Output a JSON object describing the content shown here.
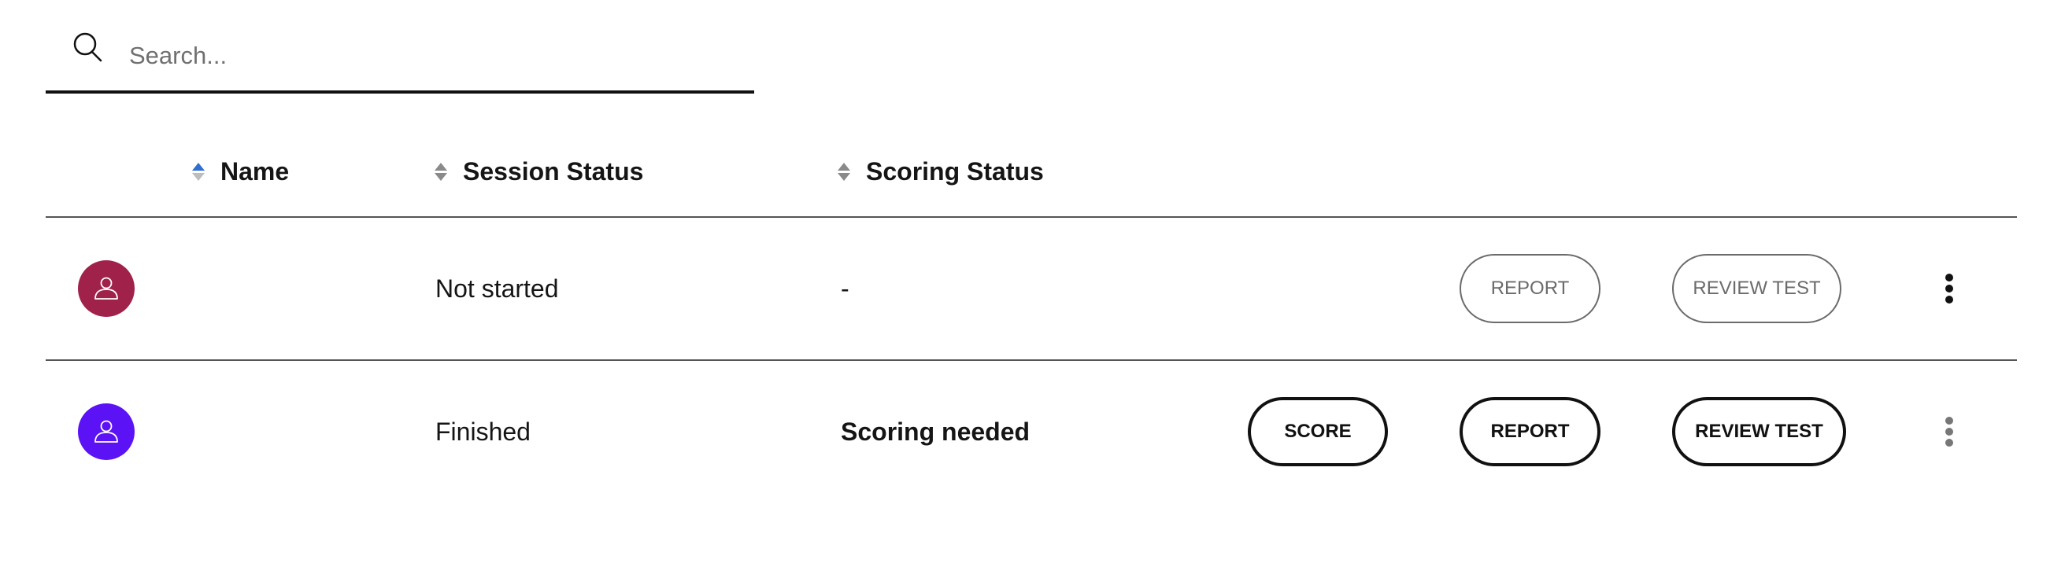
{
  "search": {
    "placeholder": "Search...",
    "value": "",
    "icon": "search-icon"
  },
  "table": {
    "columns": [
      {
        "label": "Name",
        "sort": "ascending"
      },
      {
        "label": "Session Status",
        "sort": "none"
      },
      {
        "label": "Scoring Status",
        "sort": "none"
      }
    ],
    "rows": [
      {
        "avatar_icon": "user-icon",
        "avatar_color": "#a0214a",
        "name": "",
        "session_status": "Not started",
        "scoring_status": "-",
        "actions": {
          "report": "REPORT",
          "review_test": "REVIEW TEST"
        },
        "enabled": false
      },
      {
        "avatar_icon": "user-icon",
        "avatar_color": "#5b12f5",
        "name": "",
        "session_status": "Finished",
        "scoring_status": "Scoring needed",
        "actions": {
          "score": "SCORE",
          "report": "REPORT",
          "review_test": "REVIEW TEST"
        },
        "enabled": true
      }
    ]
  },
  "colors": {
    "sort_active": "#2f6fd1",
    "sort_inactive": "#8a8a8a",
    "disabled_button": "#6b6b6b",
    "active_button": "#111111"
  }
}
